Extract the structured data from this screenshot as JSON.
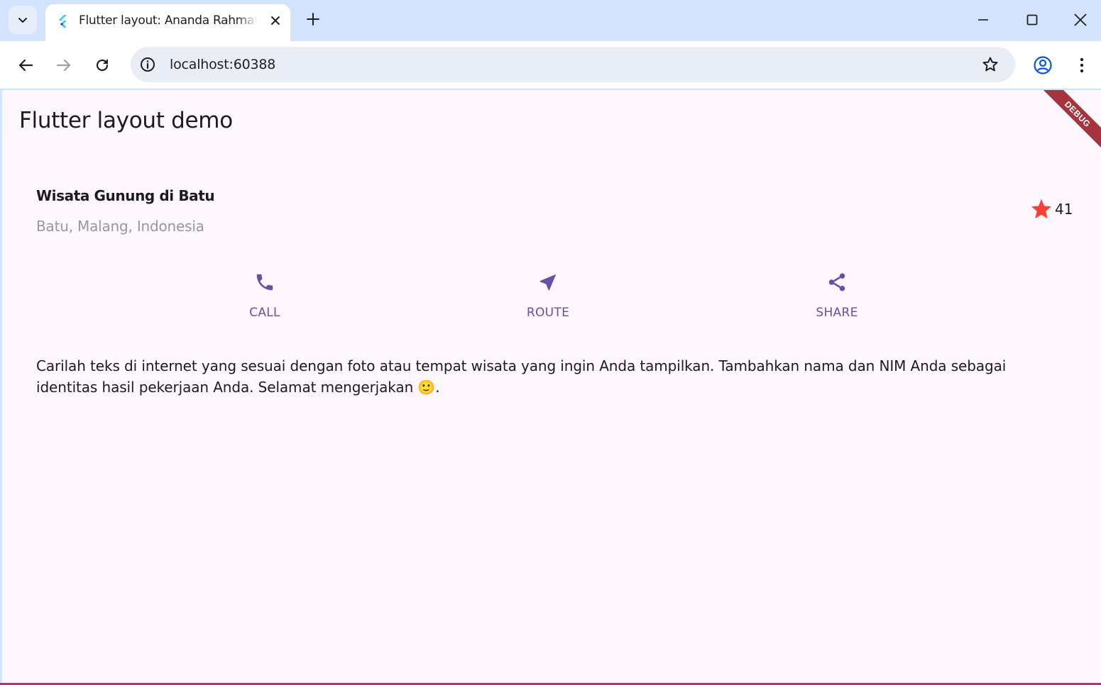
{
  "browser": {
    "tab_title": "Flutter layout: Ananda Rahmawati",
    "url": "localhost:60388"
  },
  "app": {
    "appbar_title": "Flutter layout demo",
    "debug_banner": "DEBUG",
    "place": {
      "name": "Wisata Gunung di Batu",
      "location": "Batu, Malang, Indonesia",
      "rating_count": "41"
    },
    "actions": [
      {
        "label": "CALL",
        "icon": "phone-icon"
      },
      {
        "label": "ROUTE",
        "icon": "near-me-icon"
      },
      {
        "label": "SHARE",
        "icon": "share-icon"
      }
    ],
    "description": "Carilah teks di internet yang sesuai dengan foto atau tempat wisata yang ingin Anda tampilkan. Tambahkan nama dan NIM Anda sebagai identitas hasil pekerjaan Anda. Selamat mengerjakan 🙂."
  },
  "colors": {
    "accent": "#6750a4",
    "star": "#f44336",
    "background": "#fdf6fd",
    "debug_banner": "#a5343e"
  }
}
